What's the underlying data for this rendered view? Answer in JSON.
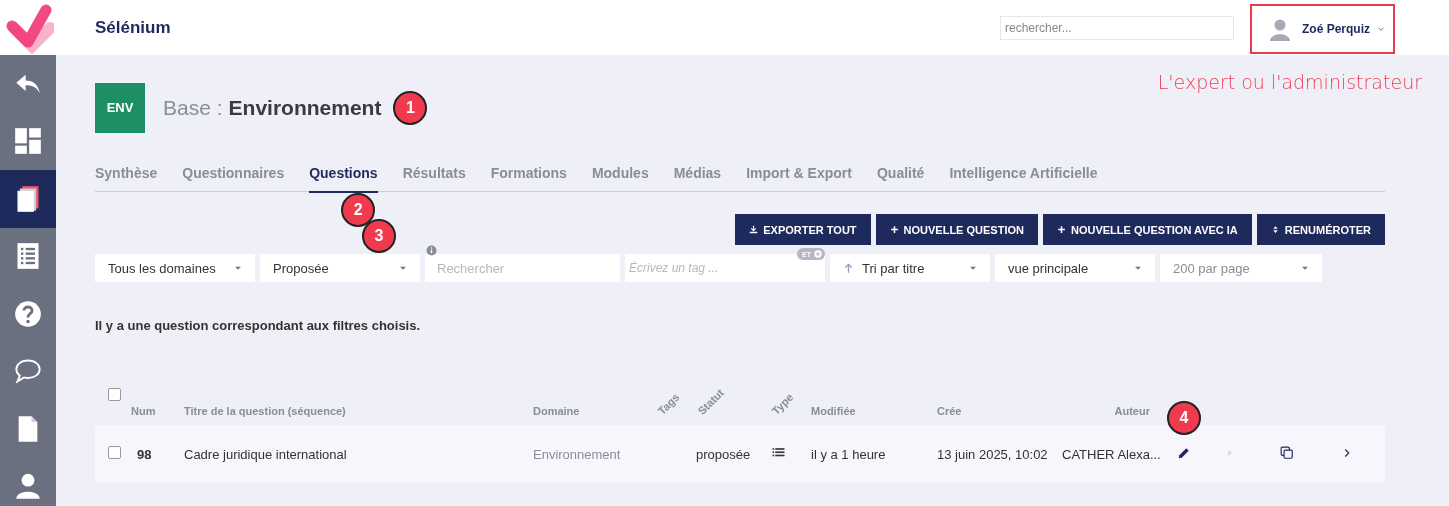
{
  "app": {
    "name": "Sélénium"
  },
  "search": {
    "placeholder": "rechercher..."
  },
  "user": {
    "name": "Zoé Perquiz",
    "highlighted": true
  },
  "annotation": {
    "text": "L'expert ou l'administrateur"
  },
  "sidebar": {
    "items": [
      {
        "kind": "back",
        "selected": false
      },
      {
        "kind": "dashboard",
        "selected": false
      },
      {
        "kind": "pages",
        "selected": true
      },
      {
        "kind": "list",
        "selected": false
      },
      {
        "kind": "help",
        "selected": false
      },
      {
        "kind": "chat",
        "selected": false
      },
      {
        "kind": "document",
        "selected": false
      },
      {
        "kind": "user",
        "selected": false
      }
    ]
  },
  "base": {
    "badge": "ENV",
    "prefix": "Base :",
    "name": "Environnement",
    "marker": "1"
  },
  "tabs": [
    {
      "label": "Synthèse",
      "selected": false
    },
    {
      "label": "Questionnaires",
      "selected": false
    },
    {
      "label": "Questions",
      "selected": true,
      "marker": "2"
    },
    {
      "label": "Résultats",
      "selected": false
    },
    {
      "label": "Formations",
      "selected": false
    },
    {
      "label": "Modules",
      "selected": false
    },
    {
      "label": "Médias",
      "selected": false
    },
    {
      "label": "Import & Export",
      "selected": false
    },
    {
      "label": "Qualité",
      "selected": false
    },
    {
      "label": "Intelligence Artificielle",
      "selected": false
    }
  ],
  "actions": [
    {
      "kind": "download",
      "label": "EXPORTER TOUT"
    },
    {
      "kind": "plus",
      "label": "NOUVELLE QUESTION"
    },
    {
      "kind": "plus",
      "label": "NOUVELLE QUESTION AVEC IA"
    },
    {
      "kind": "sort",
      "label": "RENUMÉROTER"
    }
  ],
  "filters": [
    {
      "kind": "select",
      "value": "Tous les domaines"
    },
    {
      "kind": "select",
      "value": "Proposée",
      "marker": "3"
    },
    {
      "kind": "search",
      "placeholder": "Rechercher"
    },
    {
      "kind": "tags",
      "placeholder": "Écrivez un tag ...",
      "badge": "ET"
    },
    {
      "kind": "sort",
      "value": "Tri par titre"
    },
    {
      "kind": "select",
      "value": "vue principale"
    },
    {
      "kind": "select",
      "value": "200 par page",
      "muted": true
    }
  ],
  "result_text": "Il y a une question correspondant aux filtres choisis.",
  "table": {
    "select_all_checked": false,
    "columns": [
      {
        "label": "Num",
        "kind": "plain"
      },
      {
        "label": "Titre de la question (séquence)",
        "kind": "plain"
      },
      {
        "label": "Domaine",
        "kind": "plain"
      },
      {
        "label": "Tags",
        "kind": "slanted"
      },
      {
        "label": "Statut",
        "kind": "slanted"
      },
      {
        "label": "Type",
        "kind": "slanted"
      },
      {
        "label": "Modifiée",
        "kind": "plain"
      },
      {
        "label": "Crée",
        "kind": "plain"
      },
      {
        "label": "Auteur",
        "kind": "right"
      }
    ],
    "rows": [
      {
        "checked": false,
        "num": "98",
        "title": "Cadre juridique international",
        "domain": "Environnement",
        "status": "proposée",
        "modified": "il y a 1 heure",
        "created": "13 juin 2025, 10:02",
        "author": "CATHER Alexa...",
        "marker": "4"
      }
    ]
  }
}
